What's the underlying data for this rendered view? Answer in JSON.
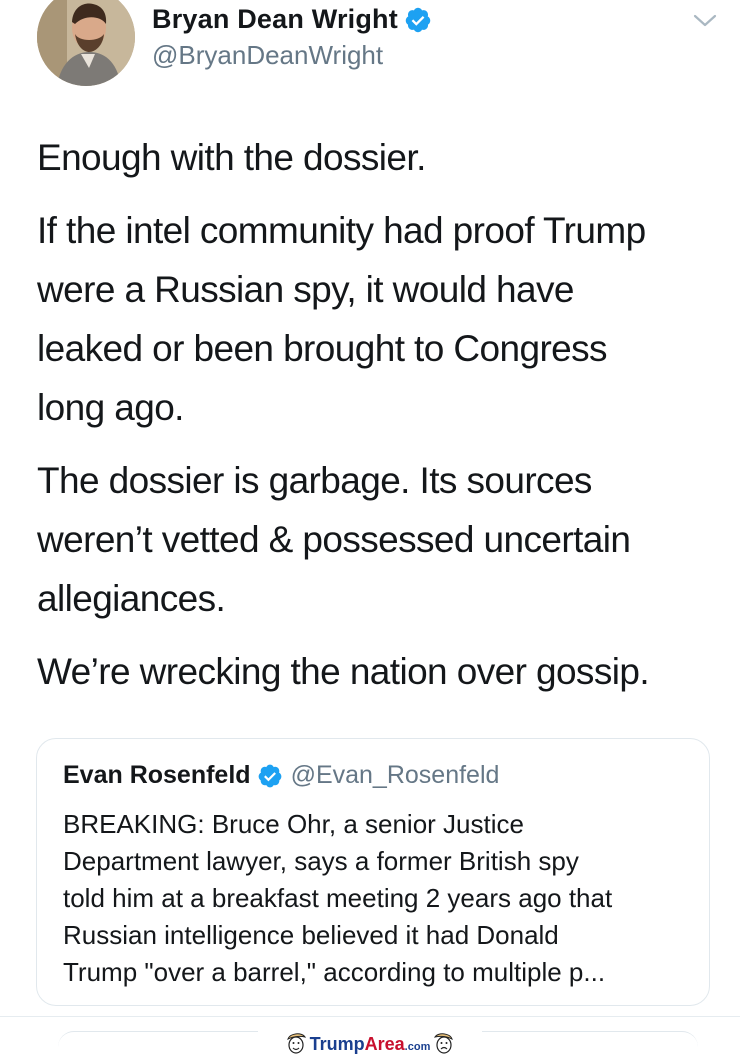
{
  "tweet": {
    "author": {
      "display_name": "Bryan Dean Wright",
      "handle": "@BryanDeanWright",
      "verified": true
    },
    "paragraphs": [
      [
        "Enough with the dossier."
      ],
      [
        "If the intel community had proof Trump",
        "were a Russian spy, it would have",
        "leaked or been brought to Congress",
        "long ago."
      ],
      [
        "The dossier is garbage. Its sources",
        "weren’t vetted & possessed uncertain",
        "allegiances."
      ],
      [
        "We’re wrecking the nation over gossip."
      ]
    ]
  },
  "quoted_tweet": {
    "display_name": "Evan Rosenfeld",
    "handle": "@Evan_Rosenfeld",
    "verified": true,
    "lines": [
      "BREAKING: Bruce Ohr, a senior Justice",
      "Department lawyer, says a former British spy",
      "told him at a breakfast meeting 2 years ago that",
      "Russian intelligence believed it had Donald",
      "Trump \"over a barrel,\" according to multiple p..."
    ]
  },
  "watermark": {
    "brand": "TrumpArea.com"
  },
  "icons": {
    "verified": "verified-badge-icon",
    "caret": "chevron-down-icon",
    "avatar": "avatar"
  },
  "colors": {
    "verified_blue": "#1da1f2",
    "secondary_text": "#657786",
    "primary_text": "#14171a",
    "card_border": "#e1e8ed"
  }
}
